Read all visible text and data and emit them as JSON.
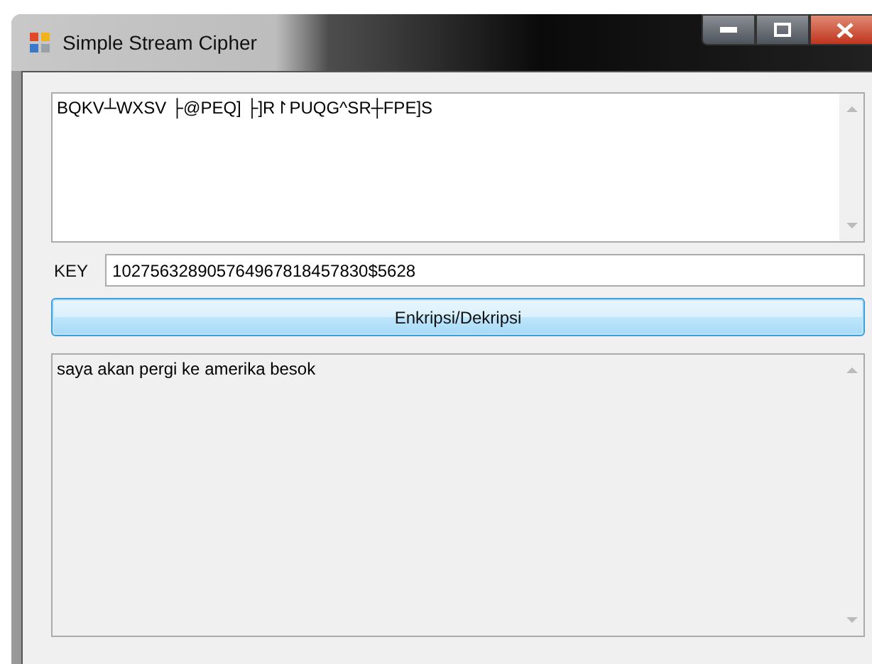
{
  "window": {
    "title": "Simple Stream Cipher"
  },
  "input_text": {
    "value": "BQKV┴WXSV ├@PEQ] ├]R↾PUQG^SR┼FPE]S"
  },
  "key": {
    "label": "KEY",
    "value": "102756328905764967818457830$5628"
  },
  "button": {
    "label": "Enkripsi/Dekripsi"
  },
  "output_text": {
    "value": "saya akan pergi ke amerika besok",
    "disabled": true
  }
}
